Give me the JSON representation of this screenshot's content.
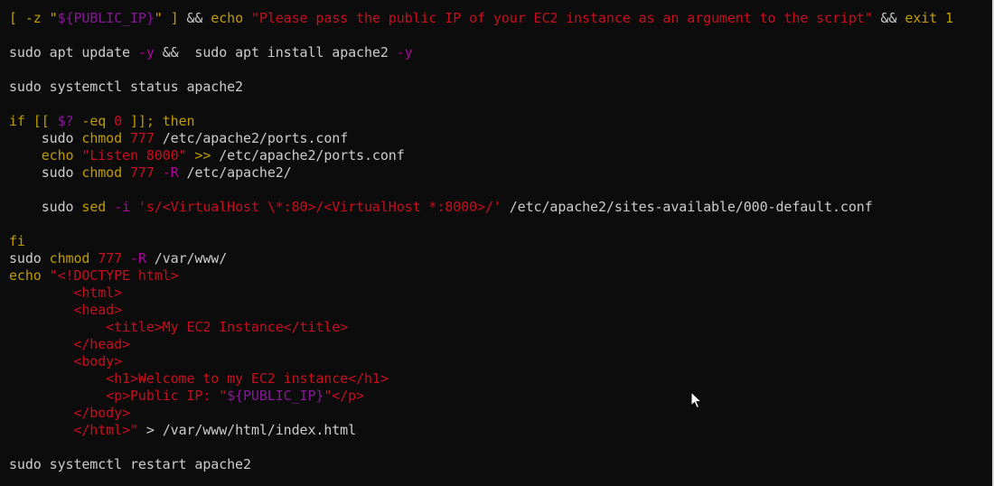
{
  "terminal": {
    "lines": [
      [
        {
          "t": "[ -z \"",
          "c": "yellow"
        },
        {
          "t": "${PUBLIC_IP}",
          "c": "purple"
        },
        {
          "t": "\" ] ",
          "c": "yellow"
        },
        {
          "t": "&& ",
          "c": "default"
        },
        {
          "t": "echo ",
          "c": "yellow"
        },
        {
          "t": "\"Please pass the public IP of your EC2 instance as an argument to the script\"",
          "c": "red"
        },
        {
          "t": " && ",
          "c": "default"
        },
        {
          "t": "exit 1",
          "c": "yellow"
        }
      ],
      [],
      [
        {
          "t": "sudo apt update ",
          "c": "default"
        },
        {
          "t": "-y",
          "c": "magenta"
        },
        {
          "t": " &&  sudo apt install apache2 ",
          "c": "default"
        },
        {
          "t": "-y",
          "c": "magenta"
        }
      ],
      [],
      [
        {
          "t": "sudo systemctl status apache2",
          "c": "default"
        }
      ],
      [],
      [
        {
          "t": "if [[ ",
          "c": "yellow"
        },
        {
          "t": "$?",
          "c": "purple"
        },
        {
          "t": " -eq ",
          "c": "yellow"
        },
        {
          "t": "0",
          "c": "red"
        },
        {
          "t": " ]]; then",
          "c": "yellow"
        }
      ],
      [
        {
          "t": "    sudo ",
          "c": "default"
        },
        {
          "t": "chmod ",
          "c": "yellow"
        },
        {
          "t": "777 ",
          "c": "red"
        },
        {
          "t": "/etc/apache2/ports.conf",
          "c": "default"
        }
      ],
      [
        {
          "t": "    ",
          "c": "default"
        },
        {
          "t": "echo ",
          "c": "yellow"
        },
        {
          "t": "\"Listen 8000\" ",
          "c": "red"
        },
        {
          "t": ">> ",
          "c": "yellow"
        },
        {
          "t": "/etc/apache2/ports.conf",
          "c": "default"
        }
      ],
      [
        {
          "t": "    sudo ",
          "c": "default"
        },
        {
          "t": "chmod ",
          "c": "yellow"
        },
        {
          "t": "777 ",
          "c": "red"
        },
        {
          "t": "-R ",
          "c": "magenta"
        },
        {
          "t": "/etc/apache2/",
          "c": "default"
        }
      ],
      [],
      [
        {
          "t": "    sudo ",
          "c": "default"
        },
        {
          "t": "sed ",
          "c": "yellow"
        },
        {
          "t": "-i ",
          "c": "magenta"
        },
        {
          "t": "'s/<VirtualHost \\*:80>/<VirtualHost *:8000>/'",
          "c": "red"
        },
        {
          "t": " /etc/apache2/sites-available/000-default.conf",
          "c": "default"
        }
      ],
      [],
      [
        {
          "t": "fi",
          "c": "yellow"
        }
      ],
      [
        {
          "t": "sudo ",
          "c": "default"
        },
        {
          "t": "chmod ",
          "c": "yellow"
        },
        {
          "t": "777 ",
          "c": "red"
        },
        {
          "t": "-R ",
          "c": "magenta"
        },
        {
          "t": "/var/www/",
          "c": "default"
        }
      ],
      [
        {
          "t": "echo ",
          "c": "yellow"
        },
        {
          "t": "\"<!DOCTYPE html>",
          "c": "red"
        }
      ],
      [
        {
          "t": "        <html>",
          "c": "red"
        }
      ],
      [
        {
          "t": "        <head>",
          "c": "red"
        }
      ],
      [
        {
          "t": "            <title>My EC2 Instance</title>",
          "c": "red"
        }
      ],
      [
        {
          "t": "        </head>",
          "c": "red"
        }
      ],
      [
        {
          "t": "        <body>",
          "c": "red"
        }
      ],
      [
        {
          "t": "            <h1>Welcome to my EC2 instance</h1>",
          "c": "red"
        }
      ],
      [
        {
          "t": "            <p>Public IP: \"",
          "c": "red"
        },
        {
          "t": "${PUBLIC_IP}",
          "c": "purple"
        },
        {
          "t": "\"</p>",
          "c": "red"
        }
      ],
      [
        {
          "t": "        </body>",
          "c": "red"
        }
      ],
      [
        {
          "t": "        </html>\"",
          "c": "red"
        },
        {
          "t": " > ",
          "c": "default"
        },
        {
          "t": "/var/www/html/index.html",
          "c": "default"
        }
      ],
      [],
      [
        {
          "t": "sudo systemctl restart apache2",
          "c": "default"
        }
      ]
    ],
    "colors": {
      "background": "#0c0c0c",
      "default": "#cccccc",
      "yellow": "#c19c00",
      "red": "#c50f1f",
      "purple": "#881798",
      "magenta": "#b4009e"
    },
    "cursor_icon": "mouse-pointer-arrow"
  }
}
